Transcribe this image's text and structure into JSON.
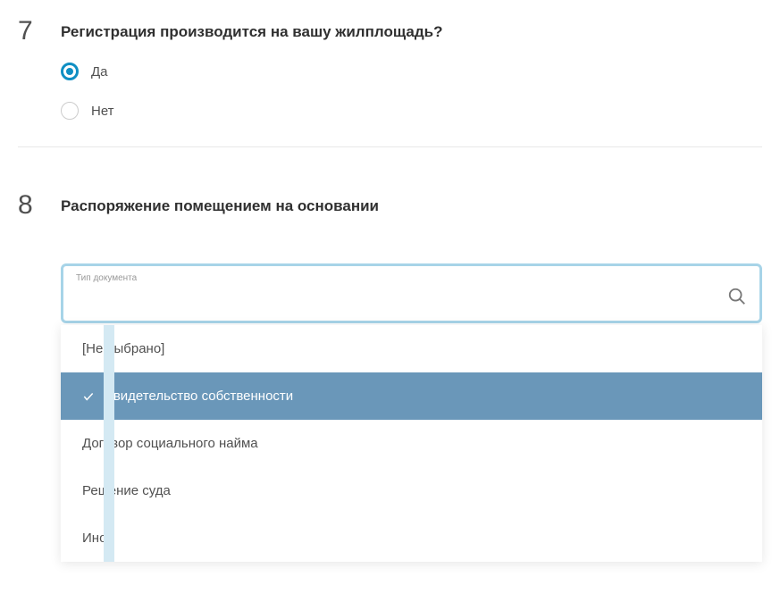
{
  "question7": {
    "number": "7",
    "title": "Регистрация производится на вашу жилплощадь?",
    "options": [
      {
        "label": "Да",
        "selected": true
      },
      {
        "label": "Нет",
        "selected": false
      }
    ]
  },
  "question8": {
    "number": "8",
    "title": "Распоряжение помещением на основании",
    "searchLabel": "Тип документа",
    "searchValue": "",
    "dropdownItems": [
      {
        "label": "[Не выбрано]",
        "selected": false
      },
      {
        "label": "Свидетельство собственности",
        "selected": true
      },
      {
        "label": "Договор социального найма",
        "selected": false
      },
      {
        "label": "Решение суда",
        "selected": false
      },
      {
        "label": "Иное",
        "selected": false
      }
    ]
  }
}
